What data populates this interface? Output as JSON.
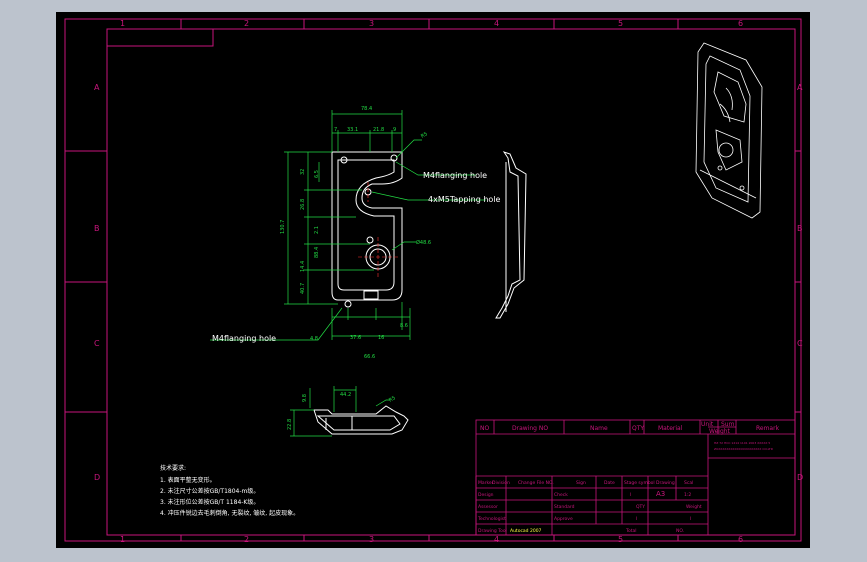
{
  "grid": {
    "columns": [
      "1",
      "2",
      "3",
      "4",
      "5",
      "6"
    ],
    "rows": [
      "A",
      "B",
      "C",
      "D"
    ]
  },
  "callouts": {
    "flanging_top": "M4flanging hole",
    "tapping": "4xM5Tapping hole",
    "flanging_bottom": "M4flanging hole"
  },
  "dimensions": {
    "top_width": "78.4",
    "top_7": "7",
    "top_33": "33.1",
    "top_21": "21.8",
    "top_9": "9",
    "r_small": "R5",
    "height_total": "130.7",
    "v_32": "32",
    "v_6_5": "6.5",
    "v_26": "26.8",
    "v_2_1": "2.1",
    "v_88": "88.4",
    "v_14": "14.4",
    "v_40": "40.7",
    "bottom_4": "4.8",
    "bottom_37": "37.6",
    "bottom_16": "16",
    "bottom_66": "66.6",
    "bottom_8": "8.6",
    "dia": "Ø48.6",
    "sec_44": "44.2",
    "sec_9": "9.8",
    "sec_22": "22.8",
    "sec_r": "R5"
  },
  "notes": {
    "title": "技术要求:",
    "lines": [
      "1. 表面平整无变形。",
      "2. 未注尺寸公差按GB/T1804-m级。",
      "3. 未注形位公差按GB/T 1184-K级。",
      "4. 冲压件锐边去毛刺倒角, 无裂纹, 皱纹, 起皮现象。"
    ]
  },
  "title_block": {
    "header": {
      "no": "NO",
      "drawing_no": "Drawing NO",
      "name": "Name",
      "qty": "QTY",
      "material": "Material",
      "unit": "Unit",
      "sum": "Sum",
      "weight": "Weight",
      "remark": "Remark"
    },
    "company_lines": [
      "HZ 72 HCC 1214 1101 2003 XXXXX 5",
      "ZUXXXXXXXXXXXXXXXXXXXXX CO.LTD"
    ],
    "rows": [
      [
        "Marker",
        "Division",
        "Change File NO.",
        "Sign",
        "Date",
        "Stage symbol",
        "Drawing",
        "Scal"
      ],
      [
        "Design",
        "",
        "",
        "Check",
        "",
        "I",
        "A3",
        "1:2"
      ],
      [
        "Assessor",
        "",
        "",
        "Standard",
        "",
        "QTY",
        "",
        "Weight"
      ],
      [
        "Technologist",
        "",
        "",
        "Approve",
        "",
        "I",
        "",
        "I"
      ],
      [
        "Drawing Tool",
        "Autocad 2007",
        "",
        "",
        "",
        "Total",
        "NO."
      ]
    ]
  }
}
